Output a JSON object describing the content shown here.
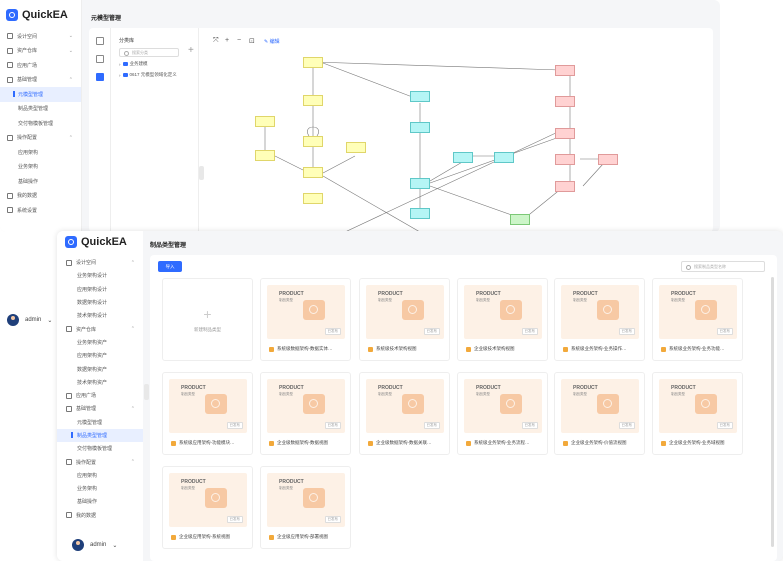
{
  "app": {
    "name": "QuickEA"
  },
  "back": {
    "page_title": "元模型管理",
    "menu": [
      {
        "label": "设计空间",
        "chev": "⌄",
        "sub": false,
        "active": false
      },
      {
        "label": "资产仓库",
        "chev": "⌄",
        "sub": false,
        "active": false
      },
      {
        "label": "应用广场",
        "chev": "",
        "sub": false,
        "active": false
      },
      {
        "label": "基础管理",
        "chev": "⌃",
        "sub": false,
        "active": false
      },
      {
        "label": "元模型管理",
        "chev": "",
        "sub": true,
        "active": true
      },
      {
        "label": "制品类型管理",
        "chev": "",
        "sub": true,
        "active": false
      },
      {
        "label": "交付物模板管理",
        "chev": "",
        "sub": true,
        "active": false
      },
      {
        "label": "操作配置",
        "chev": "⌃",
        "sub": false,
        "active": false
      },
      {
        "label": "应用架构",
        "chev": "",
        "sub": true,
        "active": false
      },
      {
        "label": "业务架构",
        "chev": "",
        "sub": true,
        "active": false
      },
      {
        "label": "基础操作",
        "chev": "",
        "sub": true,
        "active": false
      },
      {
        "label": "我的数据",
        "chev": "",
        "sub": false,
        "active": false
      },
      {
        "label": "系统设置",
        "chev": "",
        "sub": false,
        "active": false
      }
    ],
    "user": "admin",
    "tree": {
      "title": "分类库",
      "search_placeholder": "搜索分类",
      "add": "+",
      "nodes": [
        "业务建模",
        "0617 元模型领域化定义"
      ]
    },
    "canvas_tools": {
      "fit": "⤧",
      "zoom_in": "+",
      "zoom_out": "−",
      "export": "⊡",
      "edit": "编辑"
    }
  },
  "front": {
    "page_title": "制品类型管理",
    "import_button": "导入",
    "search_placeholder": "搜索制品类型名称",
    "menu": [
      {
        "label": "设计空间",
        "chev": "⌃",
        "sub": false,
        "active": false
      },
      {
        "label": "业务架构设计",
        "chev": "",
        "sub": true,
        "active": false
      },
      {
        "label": "应用架构设计",
        "chev": "",
        "sub": true,
        "active": false
      },
      {
        "label": "数据架构设计",
        "chev": "",
        "sub": true,
        "active": false
      },
      {
        "label": "技术架构设计",
        "chev": "",
        "sub": true,
        "active": false
      },
      {
        "label": "资产仓库",
        "chev": "⌃",
        "sub": false,
        "active": false
      },
      {
        "label": "业务架构资产",
        "chev": "",
        "sub": true,
        "active": false
      },
      {
        "label": "应用架构资产",
        "chev": "",
        "sub": true,
        "active": false
      },
      {
        "label": "数据架构资产",
        "chev": "",
        "sub": true,
        "active": false
      },
      {
        "label": "技术架构资产",
        "chev": "",
        "sub": true,
        "active": false
      },
      {
        "label": "应用广场",
        "chev": "",
        "sub": false,
        "active": false
      },
      {
        "label": "基础管理",
        "chev": "⌃",
        "sub": false,
        "active": false
      },
      {
        "label": "元模型管理",
        "chev": "",
        "sub": true,
        "active": false
      },
      {
        "label": "制品类型管理",
        "chev": "",
        "sub": true,
        "active": true
      },
      {
        "label": "交付物模板管理",
        "chev": "",
        "sub": true,
        "active": false
      },
      {
        "label": "操作配置",
        "chev": "⌃",
        "sub": false,
        "active": false
      },
      {
        "label": "应用架构",
        "chev": "",
        "sub": true,
        "active": false
      },
      {
        "label": "业务架构",
        "chev": "",
        "sub": true,
        "active": false
      },
      {
        "label": "基础操作",
        "chev": "",
        "sub": true,
        "active": false
      },
      {
        "label": "我的数据",
        "chev": "",
        "sub": false,
        "active": false
      }
    ],
    "user": "admin",
    "new_card_label": "新建制品类型",
    "product_title": "PRODUCT",
    "product_sub": "制品类型",
    "tag": "已发布",
    "cards": [
      "系统级数据架构-数据实体…",
      "系统级技术架构视图",
      "企业级技术架构视图",
      "系统级业务架构-业务操作…",
      "系统级业务架构-业务功能…",
      "系统级应用架构-功能模块…",
      "企业级数据架构-数据视图",
      "企业级数据架构-数据关联…",
      "系统级业务架构-业务流程…",
      "企业级业务架构-价值流视图",
      "企业级业务架构-业务域视图",
      "企业级应用架构-系统视图",
      "企业级应用架构-部署视图"
    ]
  },
  "colors": {
    "accent": "#2f6bff",
    "yellow_node": "#ffffb8",
    "cyan_node": "#b5f5f5",
    "red_node": "#ffd2d2",
    "green_node": "#ccf5c8"
  }
}
